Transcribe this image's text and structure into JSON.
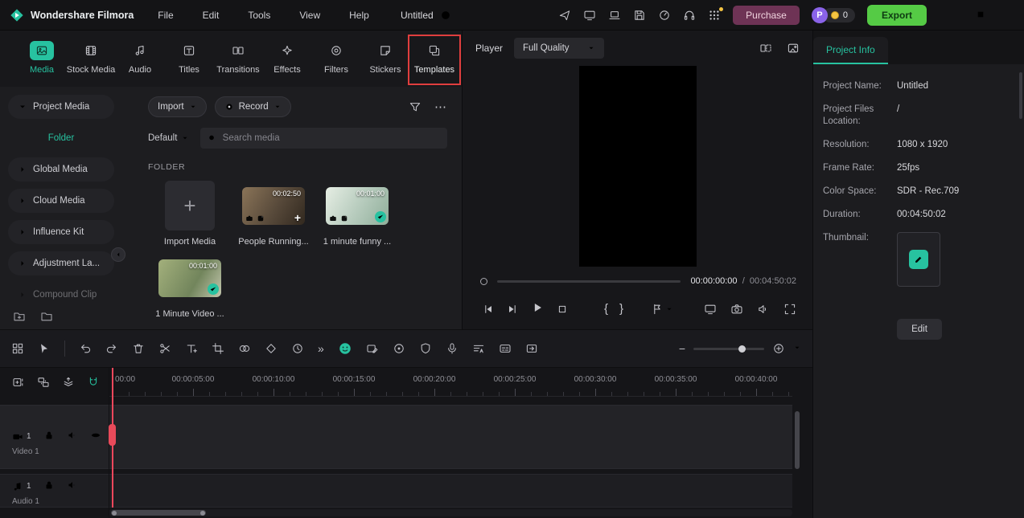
{
  "colors": {
    "accent": "#27c2a0",
    "export_green": "#55cb45",
    "highlight_red": "#e03e3e",
    "playhead_red": "#f0475c",
    "purchase_bg": "#6e3355",
    "purchase_text": "#f0d3de",
    "avatar_purple": "#8a63e8",
    "coin_yellow": "#f5c542"
  },
  "glyphs": {
    "plus": "+",
    "minus": "−",
    "more_tools": "»",
    "ellipsis": "⋯",
    "brace_in": "{",
    "brace_out": "}"
  },
  "titlebar": {
    "app_name": "Wondershare Filmora",
    "menus": [
      "File",
      "Edit",
      "Tools",
      "View",
      "Help"
    ],
    "project_title": "Untitled",
    "purchase_label": "Purchase",
    "avatar_letter": "P",
    "coin_count": "0",
    "export_label": "Export"
  },
  "media_tabs": [
    {
      "label": "Media"
    },
    {
      "label": "Stock Media"
    },
    {
      "label": "Audio"
    },
    {
      "label": "Titles"
    },
    {
      "label": "Transitions"
    },
    {
      "label": "Effects"
    },
    {
      "label": "Filters"
    },
    {
      "label": "Stickers"
    },
    {
      "label": "Templates"
    }
  ],
  "sidebar": {
    "items": [
      {
        "label": "Project Media"
      },
      {
        "label": "Folder"
      },
      {
        "label": "Global Media"
      },
      {
        "label": "Cloud Media"
      },
      {
        "label": "Influence Kit"
      },
      {
        "label": "Adjustment La..."
      },
      {
        "label": "Compound Clip"
      }
    ]
  },
  "media_panel": {
    "import_label": "Import",
    "record_label": "Record",
    "sort_label": "Default",
    "search_placeholder": "Search media",
    "section_label": "FOLDER",
    "items": [
      {
        "name": "Import Media"
      },
      {
        "name": "People Running...",
        "duration": "00:02:50"
      },
      {
        "name": "1 minute funny ...",
        "duration": "00:01:00"
      },
      {
        "name": "1 Minute Video ...",
        "duration": "00:01:00"
      }
    ]
  },
  "player": {
    "label": "Player",
    "quality": "Full Quality",
    "current_time": "00:00:00:00",
    "separator": "/",
    "total_time": "00:04:50:02"
  },
  "project_info": {
    "tab_label": "Project Info",
    "rows": [
      {
        "label": "Project Name:",
        "value": "Untitled"
      },
      {
        "label": "Project Files Location:",
        "value": "/"
      },
      {
        "label": "Resolution:",
        "value": "1080 x 1920"
      },
      {
        "label": "Frame Rate:",
        "value": "25fps"
      },
      {
        "label": "Color Space:",
        "value": "SDR - Rec.709"
      },
      {
        "label": "Duration:",
        "value": "00:04:50:02"
      },
      {
        "label": "Thumbnail:",
        "value": ""
      }
    ],
    "edit_button": "Edit"
  },
  "timeline": {
    "ruler": [
      "00:00",
      "00:00:05:00",
      "00:00:10:00",
      "00:00:15:00",
      "00:00:20:00",
      "00:00:25:00",
      "00:00:30:00",
      "00:00:35:00",
      "00:00:40:00"
    ],
    "tracks": [
      {
        "name": "Video 1",
        "badge": "1"
      },
      {
        "name": "Audio 1",
        "badge": "1"
      }
    ]
  }
}
